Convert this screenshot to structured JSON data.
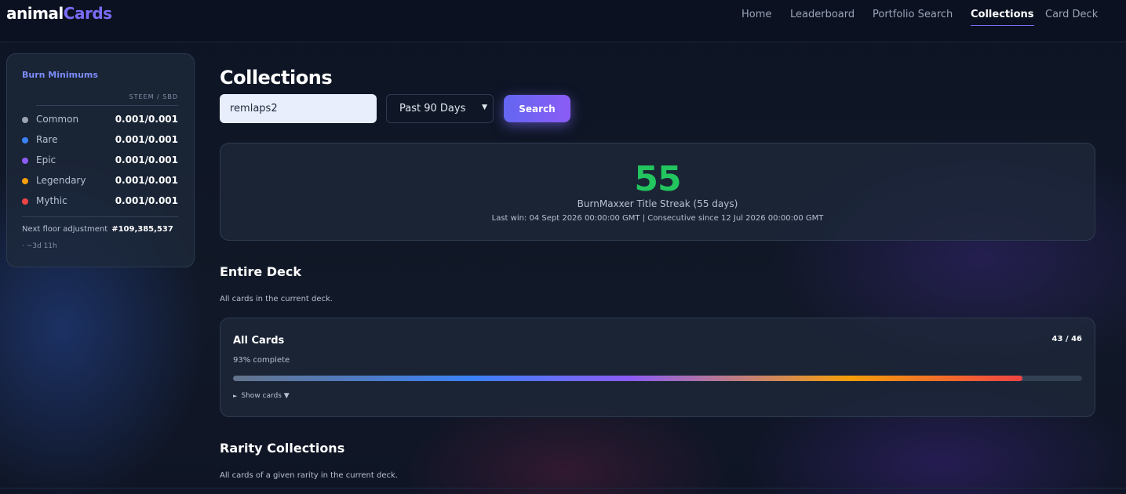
{
  "app": {
    "logo_part1": "animal",
    "logo_part2": "Cards",
    "accent_color": "#7c6cf6"
  },
  "nav": {
    "items": [
      {
        "label": "Home"
      },
      {
        "label": "Leaderboard"
      },
      {
        "label": "Portfolio Search"
      },
      {
        "label": "Collections"
      },
      {
        "label": "Card Deck"
      }
    ],
    "active": "Collections"
  },
  "sidebar": {
    "title": "Burn Minimums",
    "column_header": "STEEM / SBD",
    "rarities": [
      {
        "name": "Common",
        "value": "0.001/0.001",
        "color": "#9ca3af"
      },
      {
        "name": "Rare",
        "value": "0.001/0.001",
        "color": "#3b82f6"
      },
      {
        "name": "Epic",
        "value": "0.001/0.001",
        "color": "#8b5cf6"
      },
      {
        "name": "Legendary",
        "value": "0.001/0.001",
        "color": "#f59e0b"
      },
      {
        "name": "Mythic",
        "value": "0.001/0.001",
        "color": "#ef4444"
      }
    ],
    "floor_label": "Next floor adjustment",
    "floor_value": "#109,385,537",
    "floor_eta": "· ~3d 11h"
  },
  "main": {
    "title": "Collections",
    "search": {
      "value": "remlaps2",
      "period_selected": "Past 90 Days",
      "button_label": "Search"
    },
    "streak": {
      "number": "55",
      "label": "BurnMaxxer Title Streak (55 days)",
      "meta": "Last win: 04 Sept 2026 00:00:00 GMT | Consecutive since 12 Jul 2026 00:00:00 GMT",
      "number_color": "#22c55e"
    },
    "entire_deck": {
      "title": "Entire Deck",
      "description": "All cards in the current deck.",
      "card_title": "All Cards",
      "count": "43 / 46",
      "percent_text": "93% complete",
      "progress": 0.93,
      "show_cards_label": "Show cards ▼"
    },
    "rarity_collections": {
      "title": "Rarity Collections",
      "description": "All cards of a given rarity in the current deck."
    }
  }
}
